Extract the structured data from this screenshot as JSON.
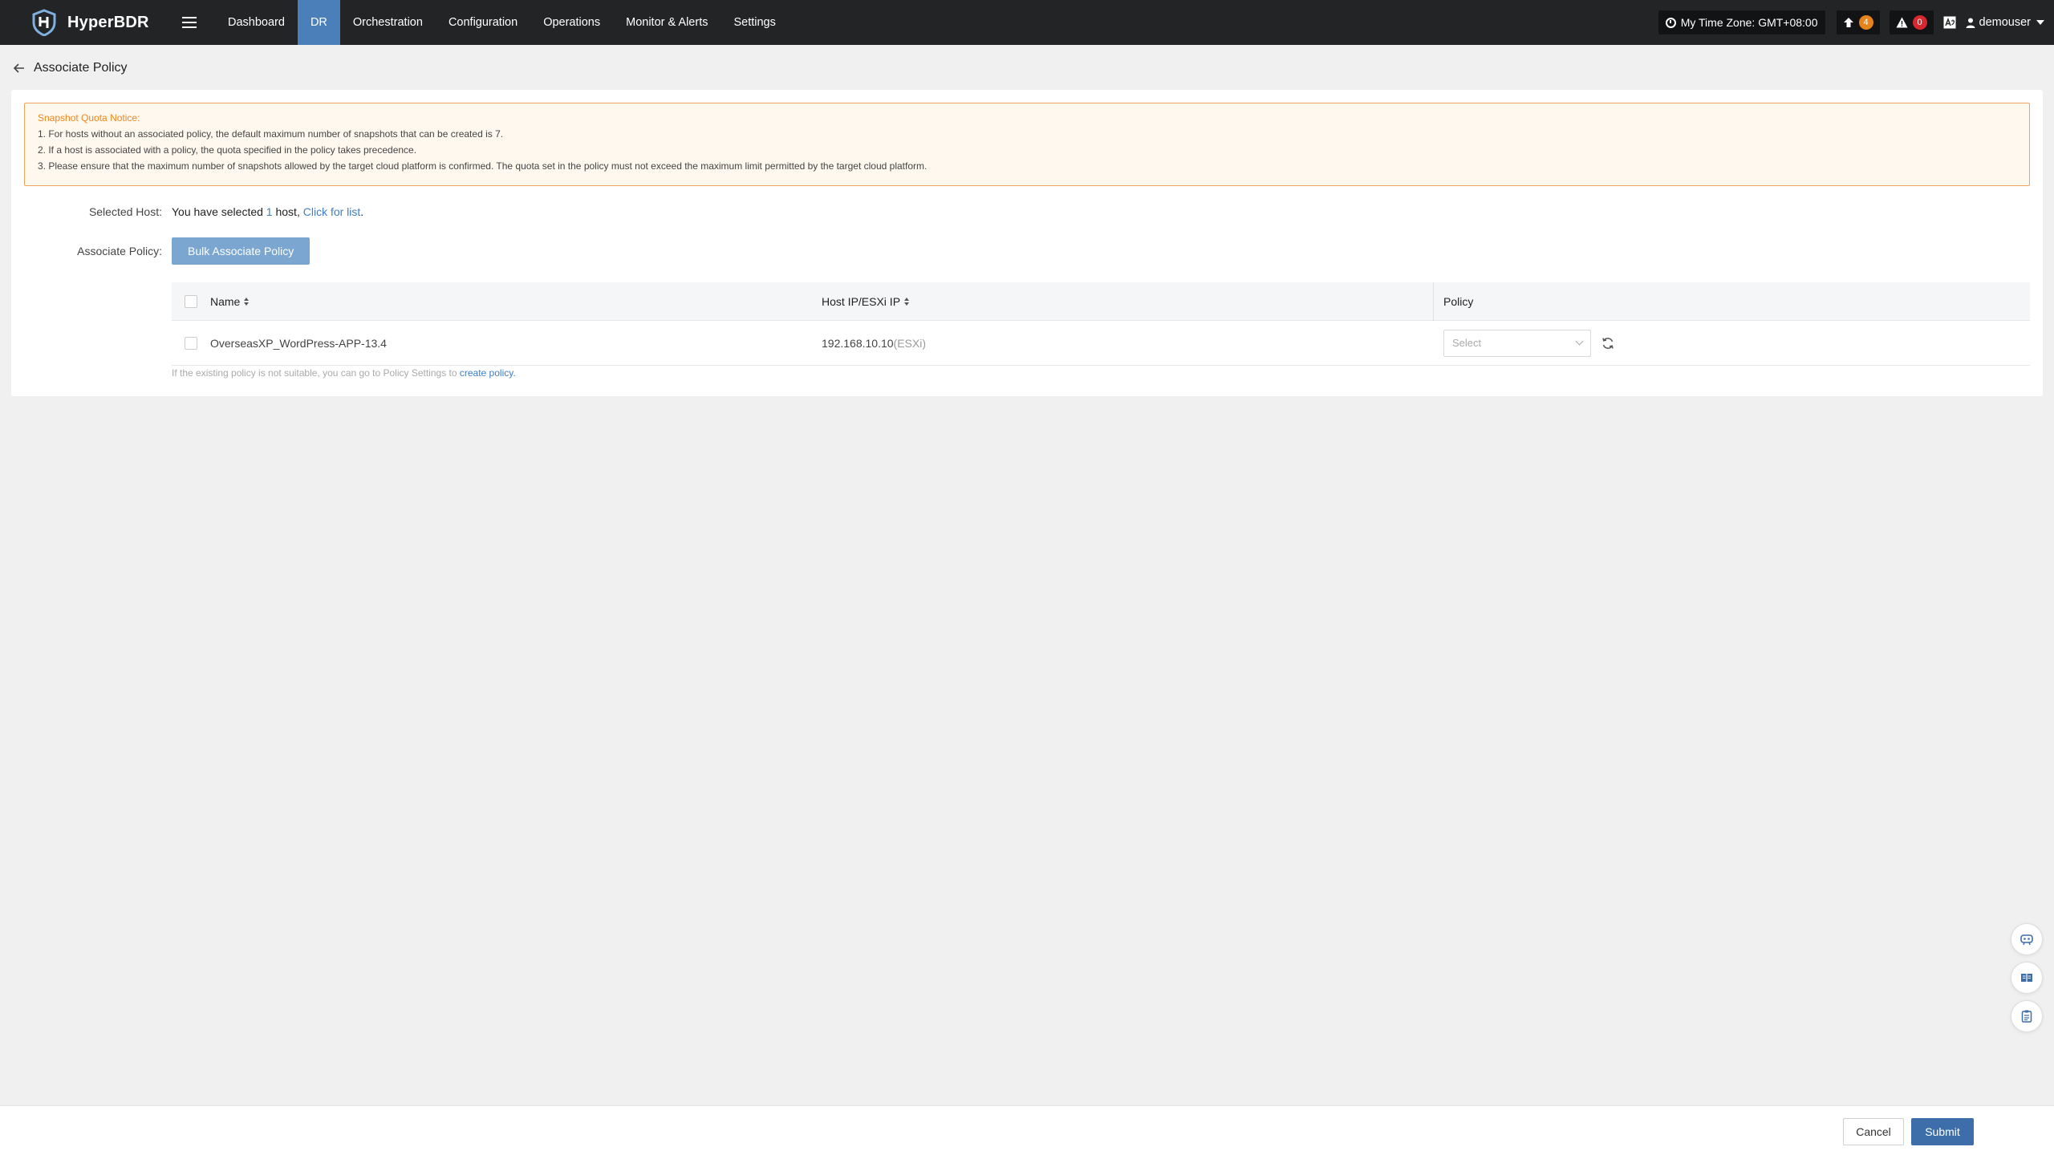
{
  "app": {
    "name": "HyperBDR"
  },
  "nav": {
    "items": [
      {
        "label": "Dashboard"
      },
      {
        "label": "DR"
      },
      {
        "label": "Orchestration"
      },
      {
        "label": "Configuration"
      },
      {
        "label": "Operations"
      },
      {
        "label": "Monitor & Alerts"
      },
      {
        "label": "Settings"
      }
    ],
    "active": "DR"
  },
  "header_right": {
    "timezone": "My Time Zone: GMT+08:00",
    "upload_count": "4",
    "alert_count": "0",
    "username": "demouser"
  },
  "page": {
    "title": "Associate Policy"
  },
  "notice": {
    "title": "Snapshot Quota Notice:",
    "lines": [
      "1. For hosts without an associated policy, the default maximum number of snapshots that can be created is 7.",
      "2. If a host is associated with a policy, the quota specified in the policy takes precedence.",
      "3. Please ensure that the maximum number of snapshots allowed by the target cloud platform is confirmed. The quota set in the policy must not exceed the maximum limit permitted by the target cloud platform."
    ]
  },
  "form": {
    "selected_host_label": "Selected Host:",
    "selected_prefix": "You have selected ",
    "selected_count": "1",
    "selected_suffix": " host, ",
    "click_for_list": "Click for list",
    "period": ".",
    "associate_policy_label": "Associate Policy:",
    "bulk_button": "Bulk Associate Policy"
  },
  "table": {
    "columns": {
      "name": "Name",
      "host_ip": "Host IP/ESXi IP",
      "policy": "Policy"
    },
    "rows": [
      {
        "name": "OverseasXP_WordPress-APP-13.4",
        "ip": "192.168.10.10",
        "ip_suffix": "(ESXi)",
        "policy_placeholder": "Select"
      }
    ]
  },
  "hint": {
    "text": "If the existing policy is not suitable, you can go to Policy Settings to ",
    "link": "create policy."
  },
  "footer": {
    "cancel": "Cancel",
    "submit": "Submit"
  },
  "colors": {
    "nav_bg": "#222426",
    "nav_active": "#4a7fb9",
    "notice_border": "#f0a35b",
    "notice_title": "#f0861b",
    "link": "#3f7ec4",
    "submit_bg": "#3d6ea9",
    "badge_orange": "#e6841b",
    "badge_red": "#d7282f"
  }
}
